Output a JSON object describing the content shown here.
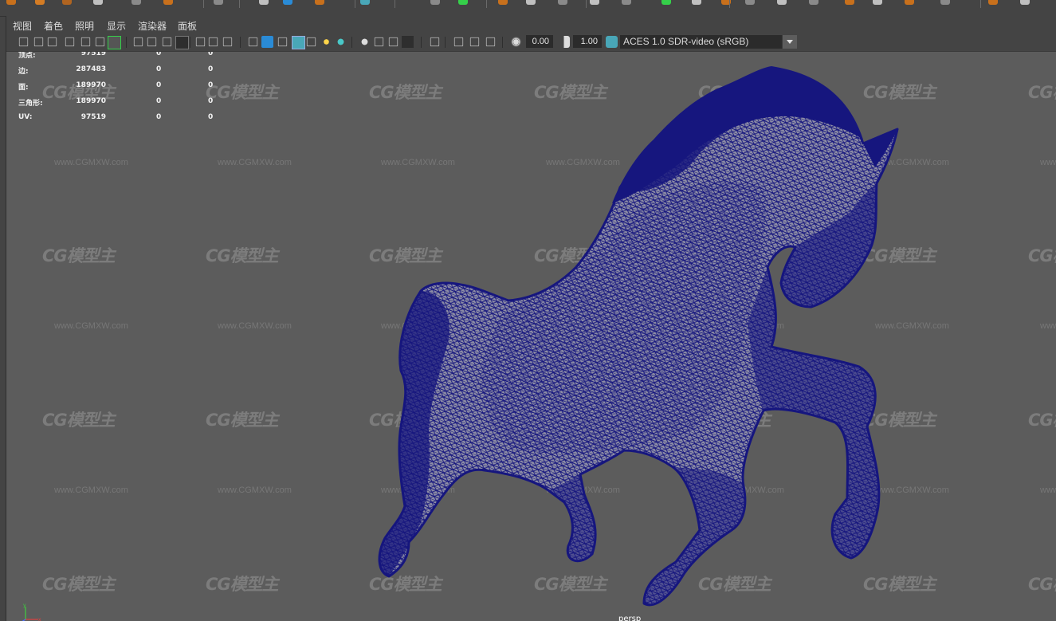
{
  "menu": [
    "视图",
    "着色",
    "照明",
    "显示",
    "渲染器",
    "面板"
  ],
  "toolbar": {
    "icons": [
      "select-camera-icon",
      "camera-attributes-icon",
      "bookmark-camera-icon",
      "bookmark-icon",
      "image-plane-icon",
      "2d-pan-zoom-icon",
      "grease-pencil-icon",
      "grid-icon",
      "film-gate-icon",
      "resolution-gate-icon",
      "gate-mask-icon",
      "field-chart-icon",
      "safe-action-icon",
      "safe-title-icon",
      "wireframe-icon",
      "smooth-shade-all-icon",
      "use-default-material-icon",
      "wireframe-on-shaded-icon",
      "xray-icon",
      "use-all-lights-icon",
      "shadows-icon",
      "screen-space-ao-icon",
      "motion-blur-icon",
      "multisample-aa-icon",
      "depth-of-field-icon",
      "isolate-select-icon",
      "xray-joints-icon",
      "xray-active-icon",
      "backface-culling-icon",
      "exposure-icon",
      "gamma-icon",
      "color-management-icon"
    ],
    "exposure": "0.00",
    "gamma": "1.00",
    "color_space": "ACES 1.0 SDR-video (sRGB)"
  },
  "hud": {
    "rows": [
      {
        "label": "顶点:",
        "a": "97519",
        "b": "0",
        "c": "0"
      },
      {
        "label": "边:",
        "a": "287483",
        "b": "0",
        "c": "0"
      },
      {
        "label": "面:",
        "a": "189970",
        "b": "0",
        "c": "0"
      },
      {
        "label": "三角形:",
        "a": "189970",
        "b": "0",
        "c": "0"
      },
      {
        "label": "UV:",
        "a": "97519",
        "b": "0",
        "c": "0"
      }
    ]
  },
  "viewport": {
    "camera": "persp",
    "watermark_logo": "CG模型主",
    "watermark_url": "www.CGMXW.com",
    "mesh_color": "#16167e",
    "background_color": "#5c5c5c"
  },
  "colors": {
    "accent_green": "#35d04a",
    "icon_blue": "#2a8bd6",
    "active_teal": "#49a7b8"
  }
}
